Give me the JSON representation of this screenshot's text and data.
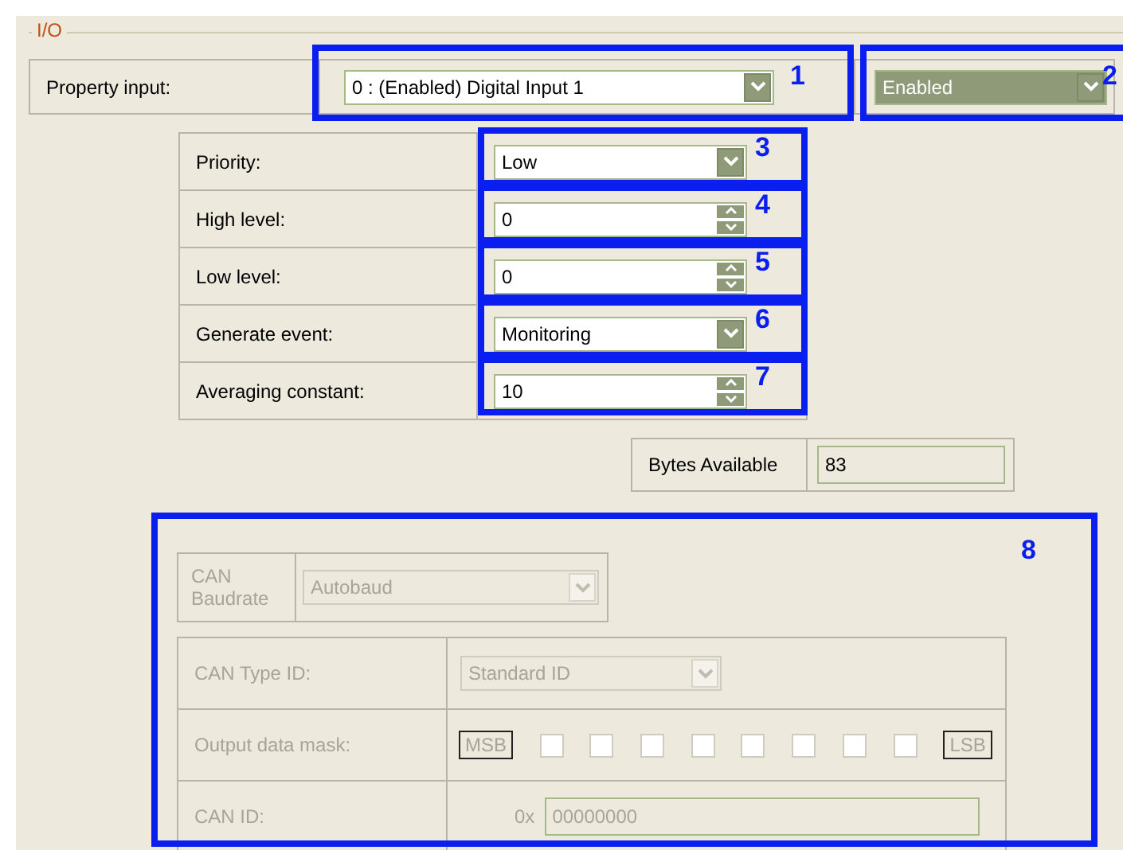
{
  "group_title": "I/O",
  "property_input": {
    "label": "Property input:",
    "value": "0 : (Enabled) Digital Input 1",
    "state_value": "Enabled"
  },
  "properties": [
    {
      "kind": "combo",
      "label": "Priority:",
      "value": "Low"
    },
    {
      "kind": "spin",
      "label": "High level:",
      "value": "0"
    },
    {
      "kind": "spin",
      "label": "Low level:",
      "value": "0"
    },
    {
      "kind": "combo",
      "label": "Generate event:",
      "value": "Monitoring"
    },
    {
      "kind": "spin",
      "label": "Averaging constant:",
      "value": "10"
    }
  ],
  "bytes_available": {
    "label": "Bytes Available",
    "value": "83"
  },
  "can": {
    "disabled": true,
    "baudrate_label": "CAN Baudrate",
    "baudrate": "Autobaud",
    "type_label": "CAN Type ID:",
    "type": "Standard ID",
    "mask_label": "Output data mask:",
    "msb": "MSB",
    "lsb": "LSB",
    "mask_bits": [
      {
        "checked": false
      },
      {
        "checked": false
      },
      {
        "checked": false
      },
      {
        "checked": false
      },
      {
        "checked": false
      },
      {
        "checked": false
      },
      {
        "checked": false
      },
      {
        "checked": false
      }
    ],
    "id_label": "CAN ID:",
    "id_prefix": "0x",
    "id": "00000000"
  },
  "callouts": [
    "1",
    "2",
    "3",
    "4",
    "5",
    "6",
    "7",
    "8"
  ]
}
